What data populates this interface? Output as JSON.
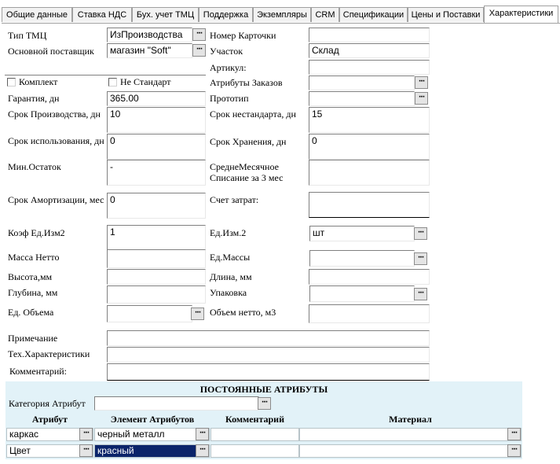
{
  "tabs": [
    {
      "label": "Общие данные"
    },
    {
      "label": "Ставка НДС"
    },
    {
      "label": "Бух. учет ТМЦ"
    },
    {
      "label": "Поддержка"
    },
    {
      "label": "Экземпляры"
    },
    {
      "label": "CRM"
    },
    {
      "label": "Спецификации"
    },
    {
      "label": "Цены и Поставки"
    },
    {
      "label": "Характеристики"
    }
  ],
  "left": {
    "tip_tmc": {
      "label": "Тип ТМЦ",
      "value": "ИзПроизводства"
    },
    "supplier": {
      "label": "Основной поставщик",
      "value": "магазин \"Soft\""
    },
    "komplekt": {
      "label": "Комплект"
    },
    "ne_standart": {
      "label": "Не Стандарт"
    },
    "garantiya": {
      "label": "Гарантия, дн",
      "value": "365.00"
    },
    "srok_proizv": {
      "label": "Срок Производства, дн",
      "value": "10"
    },
    "srok_isp": {
      "label": "Срок использования, дн",
      "value": "0"
    },
    "min_ostatok": {
      "label": "Мин.Остаток",
      "value": "-"
    },
    "srok_amort": {
      "label": "Срок Амортизации, мес",
      "value": "0"
    },
    "koef": {
      "label": "Коэф Ед.Изм2",
      "value": "1"
    },
    "massa": {
      "label": "Масса Нетто",
      "value": ""
    },
    "vysota": {
      "label": "Высота,мм",
      "value": ""
    },
    "glubina": {
      "label": "Глубина, мм",
      "value": ""
    },
    "ed_obema": {
      "label": "Ед. Объема",
      "value": ""
    },
    "primechanie": {
      "label": "Примечание",
      "value": ""
    },
    "tex_har": {
      "label": "Тех.Характеристики",
      "value": ""
    },
    "kommentariy": {
      "label": "Комментарий:",
      "value": ""
    }
  },
  "right": {
    "nomer": {
      "label": "Номер Карточки",
      "value": ""
    },
    "uchastok": {
      "label": "Участок",
      "value": "Склад"
    },
    "artikul": {
      "label": "Артикул:",
      "value": ""
    },
    "atr_zakazov": {
      "label": "Атрибуты Заказов",
      "value": ""
    },
    "prototip": {
      "label": "Прототип",
      "value": ""
    },
    "srok_nestand": {
      "label": "Срок нестандарта, дн",
      "value": "15"
    },
    "srok_hran": {
      "label": "Срок Хранения, дн",
      "value": "0"
    },
    "sredne": {
      "label": "СреднеМесячное Списание за 3 мес",
      "value": ""
    },
    "schet": {
      "label": "Счет затрат:",
      "value": ""
    },
    "ed_izm2": {
      "label": "Ед.Изм.2",
      "value": "шт"
    },
    "ed_massy": {
      "label": "Ед.Массы",
      "value": ""
    },
    "dlina": {
      "label": "Длина, мм",
      "value": ""
    },
    "upakovka": {
      "label": "Упаковка",
      "value": ""
    },
    "obem": {
      "label": "Объем нетто, м3",
      "value": ""
    }
  },
  "attributes": {
    "title": "ПОСТОЯННЫЕ АТРИБУТЫ",
    "category_label": "Категория Атрибут",
    "category_value": "",
    "col_attr": "Атрибут",
    "col_elem": "Элемент Атрибутов",
    "col_comment": "Комментарий",
    "col_material": "Материал",
    "rows": [
      {
        "attr": "каркас",
        "elem": "черный металл",
        "comment": "",
        "material": ""
      },
      {
        "attr": "Цвет",
        "elem": "красный",
        "comment": "",
        "material": ""
      }
    ]
  },
  "icons": {
    "ellipsis": "ellipsis-button-icon"
  },
  "colors": {
    "panel": "#e2f2f8",
    "selection": "#0a246a"
  }
}
